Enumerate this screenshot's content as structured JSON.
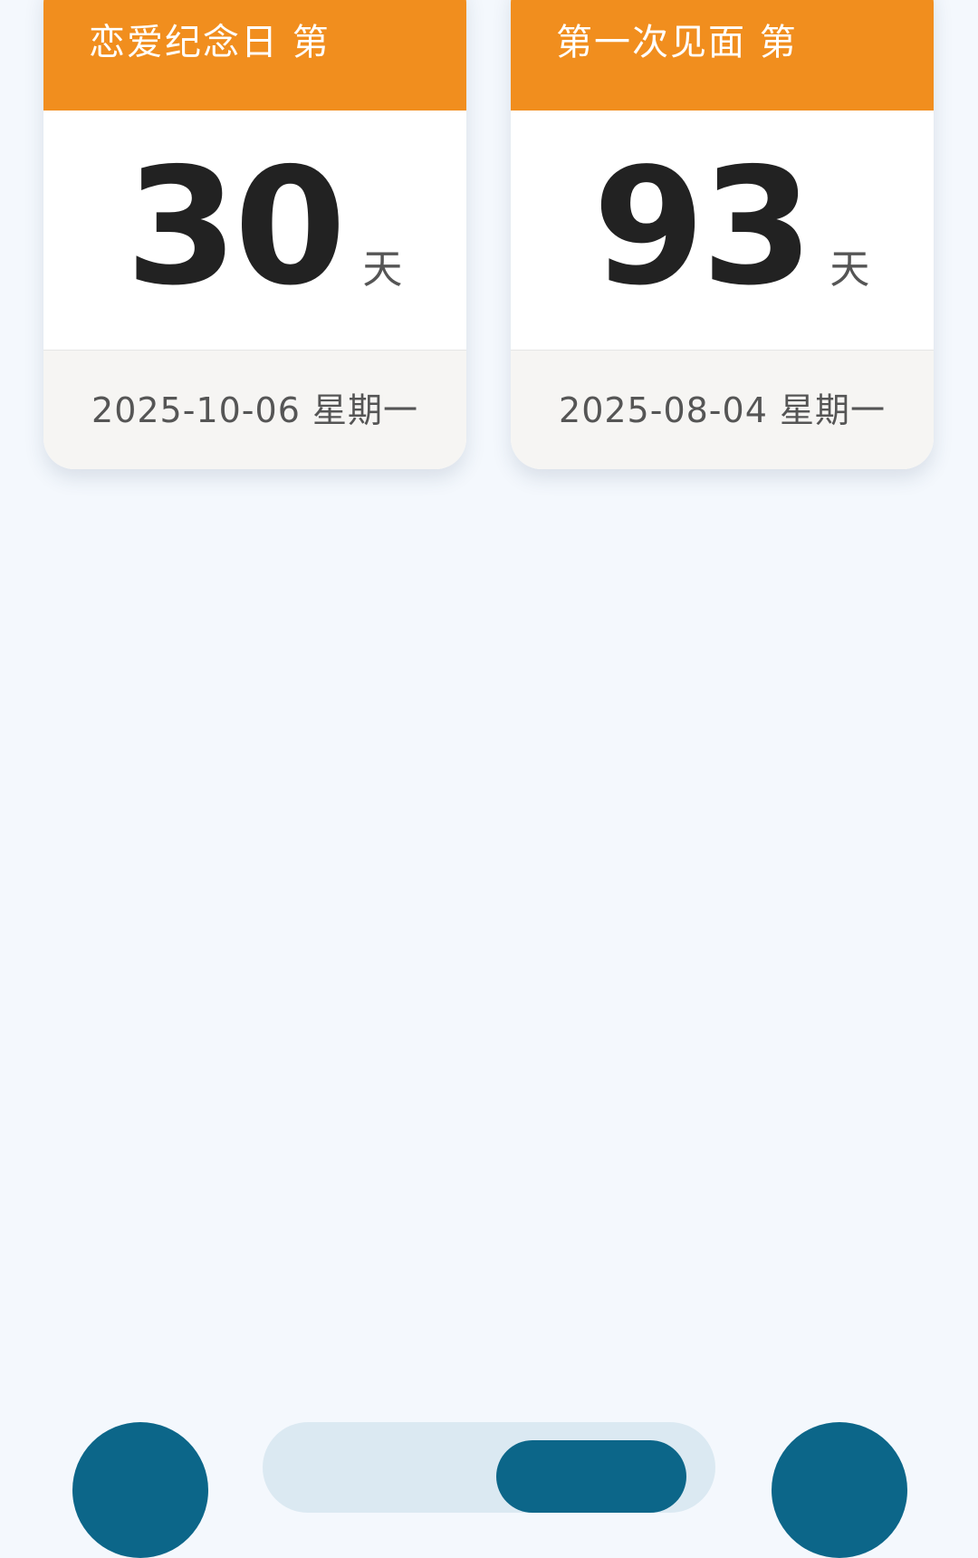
{
  "cards": [
    {
      "title": "恋爱纪念日 第",
      "number": "30",
      "unit": "天",
      "date": "2025-10-06 星期一"
    },
    {
      "title": "第一次见面 第",
      "number": "93",
      "unit": "天",
      "date": "2025-08-04 星期一"
    }
  ],
  "colors": {
    "header": "#f18e1e",
    "nav_accent": "#0c6689",
    "background": "#f4f8fd"
  },
  "nav": {
    "active_index": 1
  }
}
